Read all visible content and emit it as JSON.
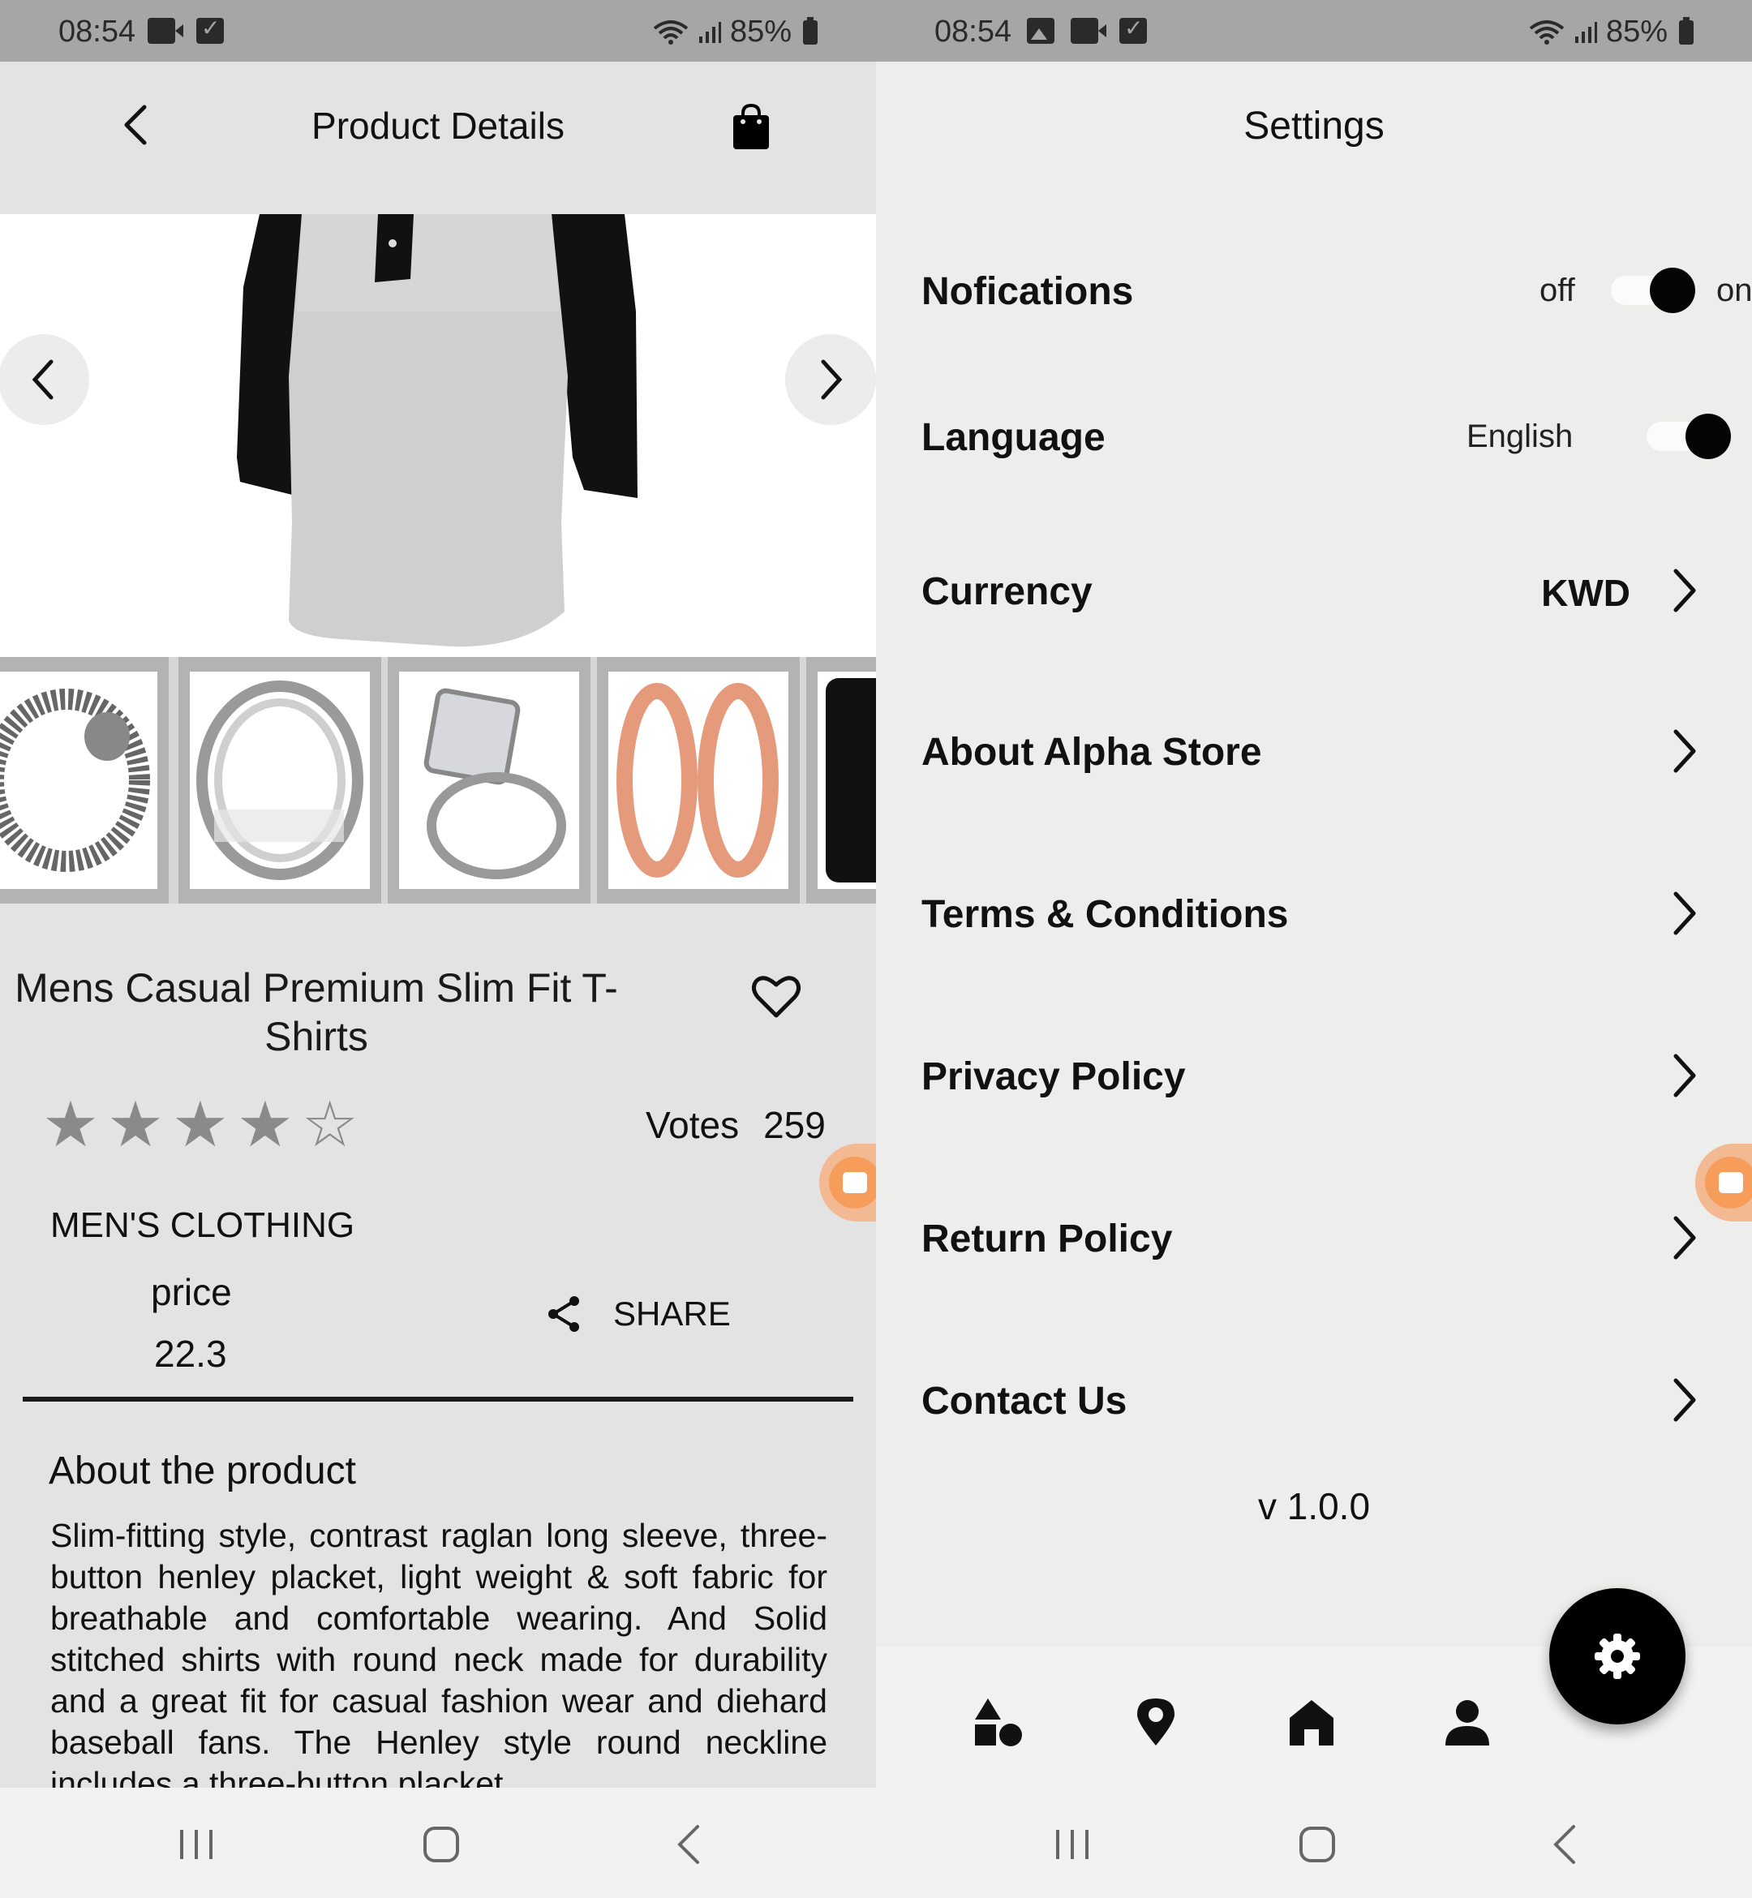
{
  "left": {
    "status": {
      "time": "08:54",
      "battery": "85%"
    },
    "header": {
      "title": "Product Details"
    },
    "product": {
      "title": "Mens Casual Premium Slim Fit T-Shirts",
      "rating": 4,
      "rating_max": 5,
      "votes_label": "Votes",
      "votes_value": "259",
      "category": "MEN'S CLOTHING",
      "price_label": "price",
      "price_value": "22.3",
      "share_label": "SHARE",
      "about_title": "About the product",
      "about_text": "Slim-fitting style, contrast raglan long sleeve, three-button henley placket, light weight & soft fabric for breathable and comfortable wearing. And Solid stitched shirts with round neck made for durability and a great fit for casual fashion wear and diehard baseball fans. The Henley style round neckline includes a three-button placket."
    },
    "thumbnails": [
      "bracelet",
      "silver-ring",
      "diamond-ring",
      "rose-gold-earrings",
      "hard-drive"
    ]
  },
  "right": {
    "status": {
      "time": "08:54",
      "battery": "85%"
    },
    "title": "Settings",
    "notifications": {
      "label": "Nofications",
      "off_label": "off",
      "on_label": "on",
      "state": "on"
    },
    "language": {
      "label": "Language",
      "value": "English",
      "state": "on"
    },
    "currency": {
      "label": "Currency",
      "value": "KWD"
    },
    "menu": [
      {
        "label": "About Alpha Store"
      },
      {
        "label": "Terms & Conditions"
      },
      {
        "label": "Privacy Policy"
      },
      {
        "label": "Return Policy"
      },
      {
        "label": "Contact Us"
      }
    ],
    "version": "v 1.0.0",
    "tabs": [
      "categories-icon",
      "location-icon",
      "home-icon",
      "profile-icon",
      "settings-icon"
    ]
  },
  "colors": {
    "accent": "#000000",
    "bubble": "#f79d5c",
    "star": "#8a8a8a"
  }
}
